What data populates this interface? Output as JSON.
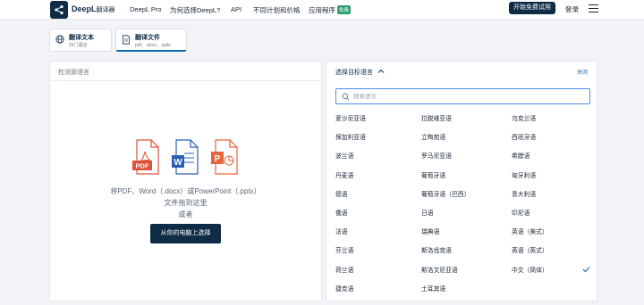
{
  "header": {
    "brand": "DeepL",
    "brand_sub": "翻译器",
    "nav": [
      {
        "label": "DeepL Pro"
      },
      {
        "label": "为何选择DeepL?"
      },
      {
        "label": "API"
      },
      {
        "label": "不同计划和价格"
      },
      {
        "label": "应用程序",
        "badge": "免费"
      }
    ],
    "cta": "开始免费试用",
    "login": "登录"
  },
  "modes": [
    {
      "title": "翻译文本",
      "subtitle": "29门语言",
      "icon": "globe-icon"
    },
    {
      "title": "翻译文件",
      "subtitle": "pdf、.docx、.pptx",
      "icon": "document-icon"
    }
  ],
  "source": {
    "header": "检测源语言",
    "drop_line1": "将PDF、Word（.docx）或PowerPoint（.pptx）",
    "drop_line2": "文件拖到这里",
    "drop_line3": "或者",
    "choose_button": "从你的电脑上选择",
    "file_icon_labels": [
      "PDF",
      "W",
      "P"
    ]
  },
  "target": {
    "header": "选择目标语言",
    "close": "关闭",
    "search_placeholder": "搜索语言",
    "selected": "中文（简体）",
    "columns": [
      [
        "爱沙尼亚语",
        "保加利亚语",
        "波兰语",
        "丹麦语",
        "德语",
        "俄语",
        "法语",
        "芬兰语",
        "荷兰语",
        "捷克语"
      ],
      [
        "拉脱维亚语",
        "立陶宛语",
        "罗马尼亚语",
        "葡萄牙语",
        "葡萄牙语（巴西）",
        "日语",
        "瑞典语",
        "斯洛伐克语",
        "斯洛文尼亚语",
        "土耳其语"
      ],
      [
        "乌克兰语",
        "西班牙语",
        "希腊语",
        "匈牙利语",
        "意大利语",
        "印尼语",
        "英语（美式）",
        "英语（英式）",
        "中文（简体）"
      ]
    ]
  },
  "colors": {
    "brand_navy": "#0f2b46",
    "accent_blue": "#0f6bb3",
    "badge_green": "#2c9d6f",
    "pdf_red": "#e0503a",
    "word_blue": "#2b5fb5",
    "ppt_orange": "#e8643c"
  }
}
